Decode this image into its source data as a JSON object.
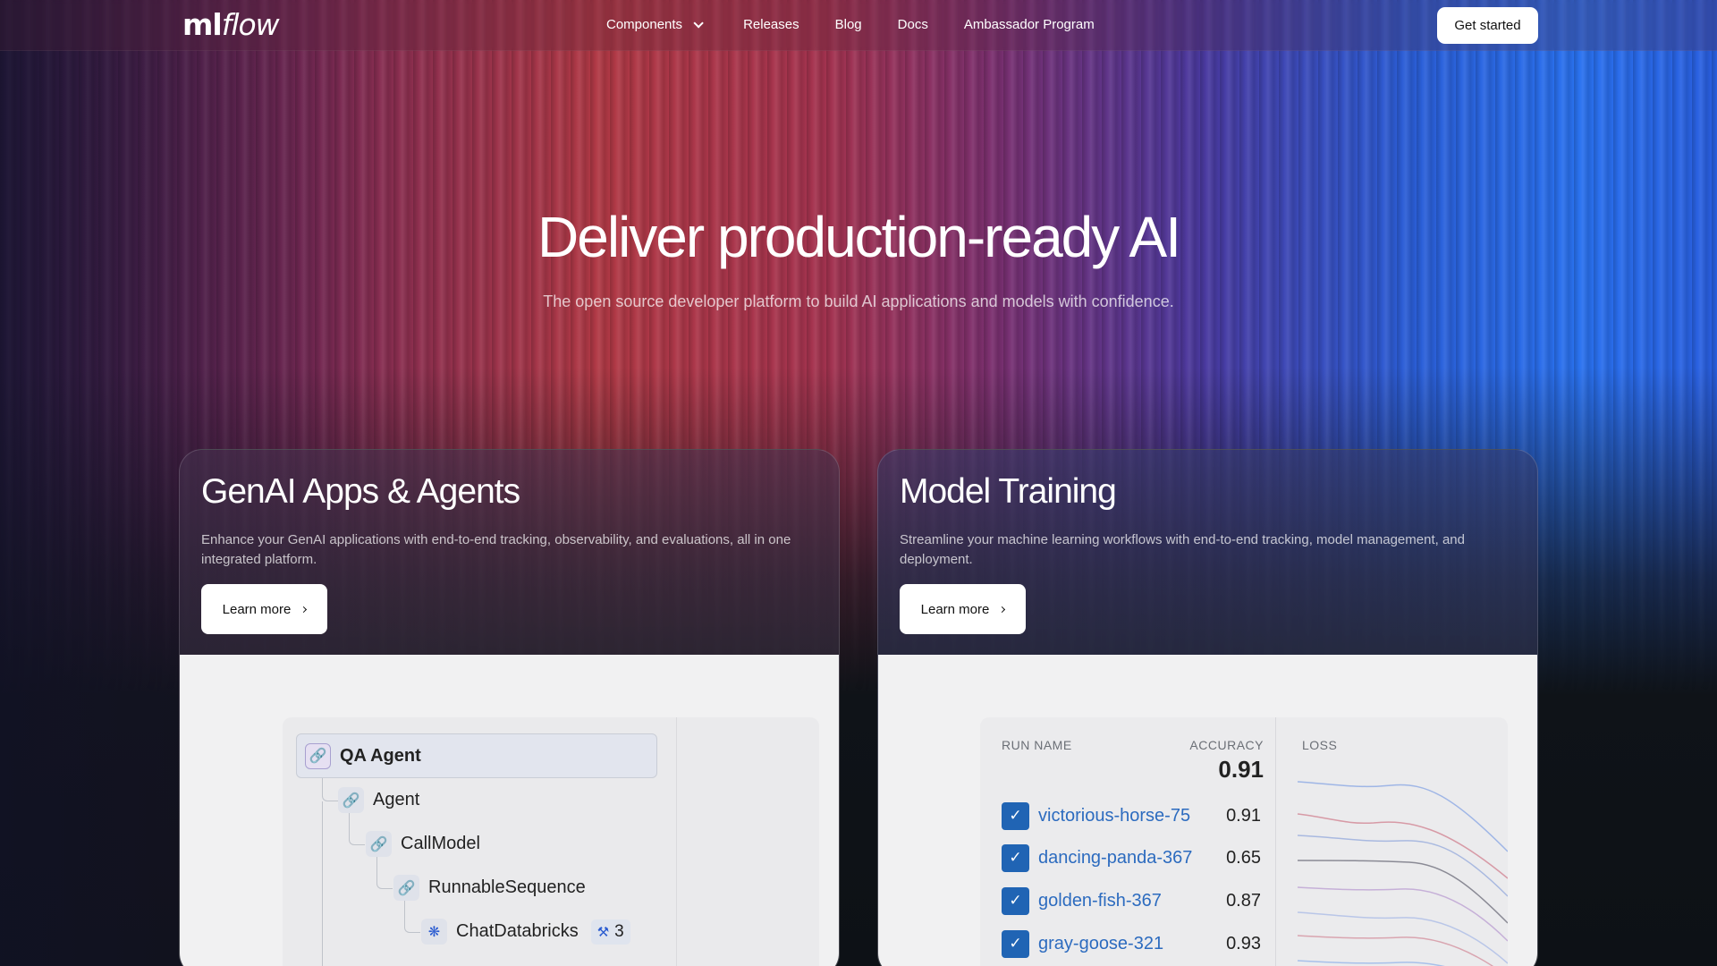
{
  "nav": {
    "logo_ml": "ml",
    "logo_flow": "flow",
    "items": [
      {
        "label": "Components"
      },
      {
        "label": "Releases"
      },
      {
        "label": "Blog"
      },
      {
        "label": "Docs"
      },
      {
        "label": "Ambassador Program"
      }
    ],
    "cta": "Get started"
  },
  "hero": {
    "title": "Deliver production-ready AI",
    "subtitle": "The open source developer platform to build AI applications and models with confidence."
  },
  "cards": [
    {
      "title": "GenAI Apps & Agents",
      "description": "Enhance your GenAI applications with end-to-end tracking, observability, and evaluations, all in one integrated platform.",
      "button": "Learn more"
    },
    {
      "title": "Model Training",
      "description": "Streamline your machine learning workflows with end-to-end tracking, model management, and deployment.",
      "button": "Learn more"
    }
  ],
  "trace": {
    "nodes": [
      {
        "label": "QA Agent"
      },
      {
        "label": "Agent"
      },
      {
        "label": "CallModel"
      },
      {
        "label": "RunnableSequence"
      },
      {
        "label": "ChatDatabricks",
        "badge": "3"
      }
    ]
  },
  "runs": {
    "headers": {
      "name": "RUN NAME",
      "accuracy": "ACCURACY",
      "loss": "LOSS"
    },
    "accuracy_summary": "0.91",
    "rows": [
      {
        "name": "victorious-horse-75",
        "accuracy": "0.91"
      },
      {
        "name": "dancing-panda-367",
        "accuracy": "0.65"
      },
      {
        "name": "golden-fish-367",
        "accuracy": "0.87"
      },
      {
        "name": "gray-goose-321",
        "accuracy": "0.93"
      }
    ]
  },
  "colors": {
    "accent_blue": "#2064b4",
    "link_blue": "#2c6bbf"
  }
}
